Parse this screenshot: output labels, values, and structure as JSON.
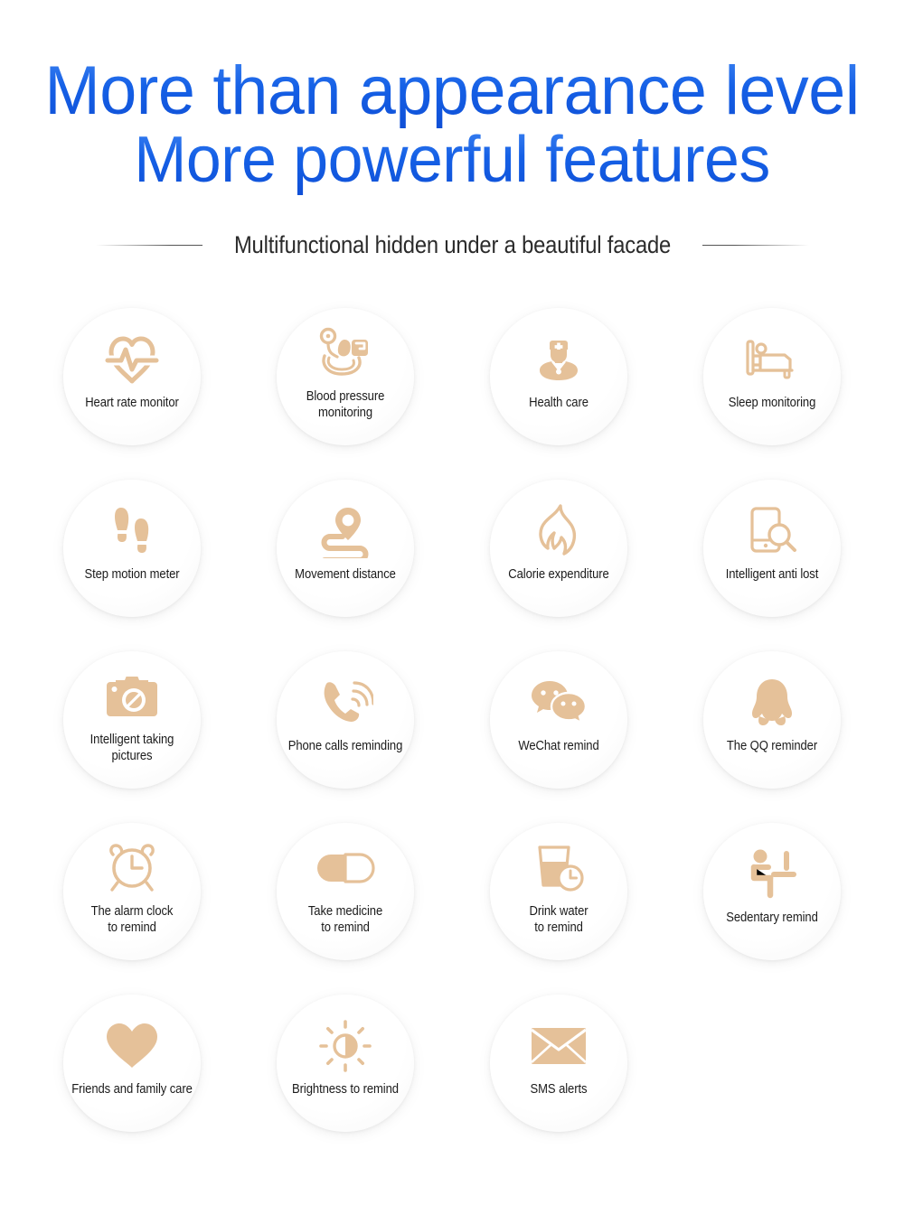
{
  "header": {
    "title_line1": "More than appearance level",
    "title_line2": "More powerful features",
    "subtitle": "Multifunctional hidden under a beautiful facade",
    "title_color": "#1560e6",
    "subtitle_color": "#2b2b2b"
  },
  "theme": {
    "icon_color": "#e5c199",
    "bubble_bg": "#ffffff",
    "page_bg": "#ffffff"
  },
  "features": [
    {
      "label": "Heart rate monitor",
      "icon": "heart-rate-icon"
    },
    {
      "label": "Blood pressure\nmonitoring",
      "icon": "blood-pressure-icon"
    },
    {
      "label": "Health care",
      "icon": "health-care-icon"
    },
    {
      "label": "Sleep monitoring",
      "icon": "sleep-bed-icon"
    },
    {
      "label": "Step motion meter",
      "icon": "footsteps-icon"
    },
    {
      "label": "Movement distance",
      "icon": "map-pin-path-icon"
    },
    {
      "label": "Calorie expenditure",
      "icon": "flame-icon"
    },
    {
      "label": "Intelligent anti lost",
      "icon": "phone-search-icon"
    },
    {
      "label": "Intelligent taking\npictures",
      "icon": "camera-icon"
    },
    {
      "label": "Phone calls reminding",
      "icon": "phone-call-icon"
    },
    {
      "label": "WeChat remind",
      "icon": "wechat-icon"
    },
    {
      "label": "The QQ reminder",
      "icon": "qq-penguin-icon"
    },
    {
      "label": "The alarm clock\nto remind",
      "icon": "alarm-clock-icon"
    },
    {
      "label": "Take medicine\nto remind",
      "icon": "pill-capsule-icon"
    },
    {
      "label": "Drink water\nto remind",
      "icon": "water-glass-clock-icon"
    },
    {
      "label": "Sedentary remind",
      "icon": "sedentary-person-icon"
    },
    {
      "label": "Friends and family care",
      "icon": "heart-filled-icon"
    },
    {
      "label": "Brightness to remind",
      "icon": "brightness-sun-icon"
    },
    {
      "label": "SMS alerts",
      "icon": "envelope-icon"
    }
  ]
}
